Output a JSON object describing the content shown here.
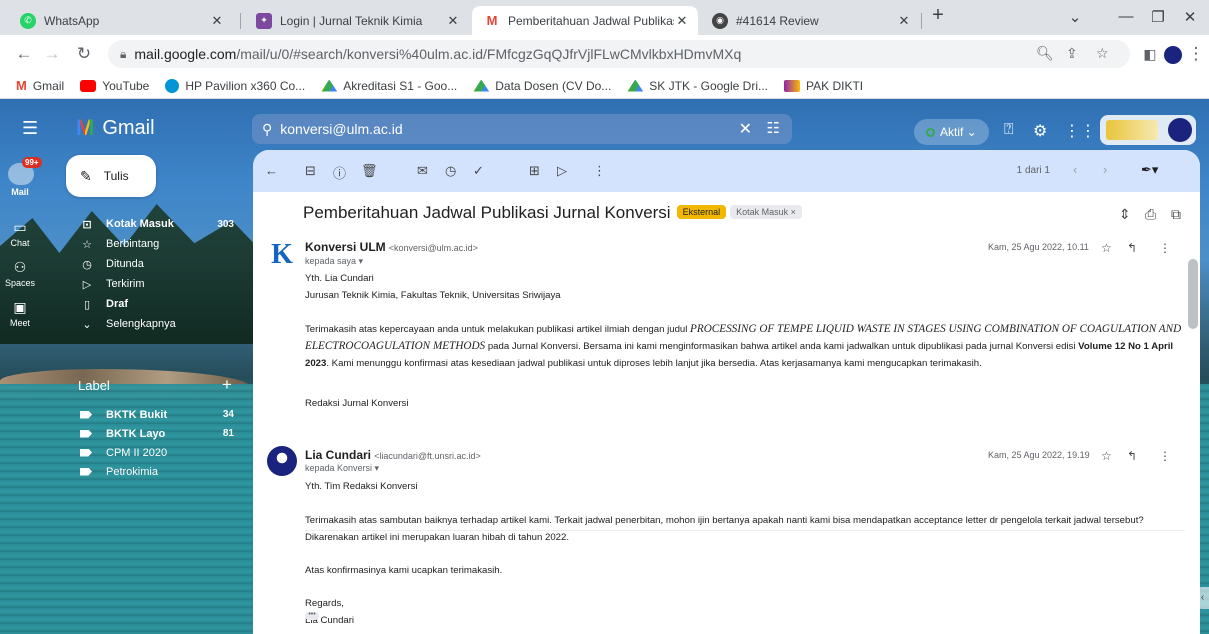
{
  "browser": {
    "tabs": [
      {
        "title": "WhatsApp",
        "icon": "whatsapp-icon",
        "color": "#25d366"
      },
      {
        "title": "Login | Jurnal Teknik Kimia",
        "icon": "jtk-icon",
        "color": "#7b4a9e"
      },
      {
        "title": "Pemberitahuan Jadwal Publikasi",
        "icon": "gmail-icon",
        "color": "#ea4335"
      },
      {
        "title": "#41614 Review",
        "icon": "review-icon",
        "color": "#444444"
      }
    ],
    "new_tab": "+",
    "url_host": "mail.google.com",
    "url_path": "/mail/u/0/#search/konversi%40ulm.ac.id/FMfcgzGqQJfrVjlFLwCMvlkbxHDmvMXq",
    "bookmarks": [
      {
        "label": "Gmail",
        "icon": "gmail-icon",
        "color": "#ea4335"
      },
      {
        "label": "YouTube",
        "icon": "youtube-icon",
        "color": "#ff0000"
      },
      {
        "label": "HP Pavilion x360 Co...",
        "icon": "hp-icon",
        "color": "#0096d6"
      },
      {
        "label": "Akreditasi S1 - Goo...",
        "icon": "drive-icon",
        "color": "#fbbc04"
      },
      {
        "label": "Data Dosen (CV Do...",
        "icon": "drive-icon",
        "color": "#fbbc04"
      },
      {
        "label": "SK JTK - Google Dri...",
        "icon": "drive-icon",
        "color": "#fbbc04"
      },
      {
        "label": "PAK DIKTI",
        "icon": "pak-icon",
        "color": "#8e24aa"
      }
    ]
  },
  "gmail": {
    "product": "Gmail",
    "search_value": "konversi@ulm.ac.id",
    "status": "Aktif",
    "rail": [
      {
        "label": "Mail",
        "icon": "mail-icon",
        "badge": "99+"
      },
      {
        "label": "Chat",
        "icon": "chat-icon"
      },
      {
        "label": "Spaces",
        "icon": "spaces-icon"
      },
      {
        "label": "Meet",
        "icon": "meet-icon"
      }
    ],
    "compose": "Tulis",
    "nav": [
      {
        "label": "Kotak Masuk",
        "count": "303",
        "icon": "inbox-icon",
        "bold": true
      },
      {
        "label": "Berbintang",
        "count": "",
        "icon": "star-icon"
      },
      {
        "label": "Ditunda",
        "count": "",
        "icon": "clock-icon"
      },
      {
        "label": "Terkirim",
        "count": "",
        "icon": "send-icon"
      },
      {
        "label": "Draf",
        "count": "",
        "icon": "draft-icon",
        "bold": true
      },
      {
        "label": "Selengkapnya",
        "count": "",
        "icon": "chevron-down-icon"
      }
    ],
    "label_header": "Label",
    "labels": [
      {
        "label": "BKTK Bukit",
        "count": "34",
        "bold": true
      },
      {
        "label": "BKTK Layo",
        "count": "81",
        "bold": true
      },
      {
        "label": "CPM II 2020",
        "count": ""
      },
      {
        "label": "Petrokimia",
        "count": ""
      }
    ],
    "pager": "1 dari 1",
    "subject": "Pemberitahuan Jadwal Publikasi Jurnal Konversi",
    "chip_external": "Eksternal",
    "chip_inbox": "Kotak Masuk ×",
    "messages": [
      {
        "sender_name": "Konversi ULM",
        "sender_email": "<konversi@ulm.ac.id>",
        "to": "kepada saya ▾",
        "date": "Kam, 25 Agu 2022, 10.11",
        "salutation": "Yth. Lia Cundari",
        "affiliation": "Jurusan Teknik Kimia, Fakultas Teknik, Universitas Sriwijaya",
        "p1_before": "Terimakasih atas kepercayaan anda untuk melakukan publikasi artikel ilmiah dengan judul ",
        "p1_title": "PROCESSING OF TEMPE LIQUID WASTE IN STAGES USING COMBINATION OF COAGULATION AND ELECTROCOAGULATION METHODS",
        "p1_after": " pada Jurnal Konversi. Bersama ini kami menginformasikan bahwa artikel anda kami jadwalkan untuk dipublikasi pada jurnal Konversi edisi ",
        "p1_volume": "Volume 12 No 1 April 2023",
        "p1_end": ". Kami menunggu konfirmasi atas kesediaan jadwal publikasi untuk diproses lebih lanjut jika bersedia. Atas kerjasamanya kami mengucapkan terimakasih.",
        "signoff": "Redaksi Jurnal Konversi"
      },
      {
        "sender_name": "Lia Cundari",
        "sender_email": "<liacundari@ft.unsri.ac.id>",
        "to": "kepada Konversi ▾",
        "date": "Kam, 25 Agu 2022, 19.19",
        "salutation": "Yth. Tim Redaksi Konversi",
        "p1": "Terimakasih atas sambutan baiknya terhadap artikel kami. Terkait jadwal penerbitan, mohon ijin bertanya apakah nanti kami bisa mendapatkan acceptance letter dr pengelola terkait jadwal tersebut? Dikarenakan artikel ini merupakan luaran hibah di tahun 2022.",
        "p2": "Atas konfirmasinya kami ucapkan terimakasih.",
        "regards": "Regards,",
        "name": "Lia Cundari"
      }
    ]
  }
}
